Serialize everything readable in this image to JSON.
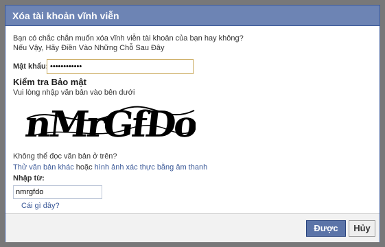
{
  "dialog": {
    "title": "Xóa tài khoản vĩnh viễn",
    "prompt_line1": "Bạn có chắc chắn muốn xóa vĩnh viễn tài khoản của bạn hay không?",
    "prompt_line2": "Nếu Vậy, Hãy Điền Vào Những Chỗ Sau Đây",
    "password_label": "Mật khẩu:",
    "password_value": "••••••••••••",
    "security_title": "Kiểm tra Bảo mật",
    "security_sub": "Vui lòng nhập văn bản vào bên dưới",
    "captcha_text": "nMrGfDo",
    "cant_read": "Không thể đọc văn bản ở trên?",
    "alt_try": "Thử văn bản khác",
    "alt_or": " hoặc ",
    "alt_audio": "hình ảnh xác thực bằng âm thanh",
    "enter_label": "Nhập từ:",
    "captcha_input_value": "nmrgfdo",
    "whats_this": "Cái gì đây?",
    "ok_label": "Được",
    "cancel_label": "Hủy"
  },
  "colors": {
    "titlebar": "#6d84b4",
    "link": "#3b5998",
    "primary_button": "#5b74a8"
  }
}
